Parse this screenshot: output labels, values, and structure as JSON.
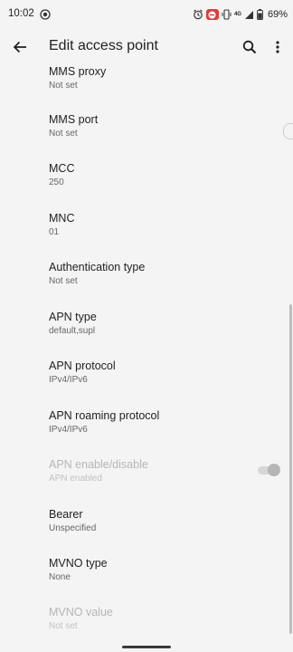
{
  "status_bar": {
    "time": "10:02",
    "network_label": "4G",
    "battery": "69%"
  },
  "app_bar": {
    "title": "Edit access point"
  },
  "preferences": [
    {
      "title": "MMS proxy",
      "summary": "Not set"
    },
    {
      "title": "MMS port",
      "summary": "Not set"
    },
    {
      "title": "MCC",
      "summary": "250"
    },
    {
      "title": "MNC",
      "summary": "01"
    },
    {
      "title": "Authentication type",
      "summary": "Not set"
    },
    {
      "title": "APN type",
      "summary": "default,supl"
    },
    {
      "title": "APN protocol",
      "summary": "IPv4/IPv6"
    },
    {
      "title": "APN roaming protocol",
      "summary": "IPv4/IPv6"
    },
    {
      "title": "APN enable/disable",
      "summary": "APN enabled",
      "disabled": true,
      "toggle_on": true
    },
    {
      "title": "Bearer",
      "summary": "Unspecified"
    },
    {
      "title": "MVNO type",
      "summary": "None"
    },
    {
      "title": "MVNO value",
      "summary": "Not set",
      "disabled": true
    }
  ],
  "colors": {
    "background": "#f4f4f4",
    "text_primary": "#1f1f1f",
    "text_secondary": "#666666",
    "text_disabled": "#b6b6b6",
    "dnd_badge": "#e53935"
  },
  "icons": {
    "status_left": "record-icon",
    "alarm": "alarm-icon",
    "dnd": "do-not-disturb-icon",
    "vibrate": "vibrate-icon",
    "signal": "signal-icon",
    "battery": "battery-icon",
    "back": "arrow-back-icon",
    "search": "search-icon",
    "more": "more-vert-icon"
  }
}
